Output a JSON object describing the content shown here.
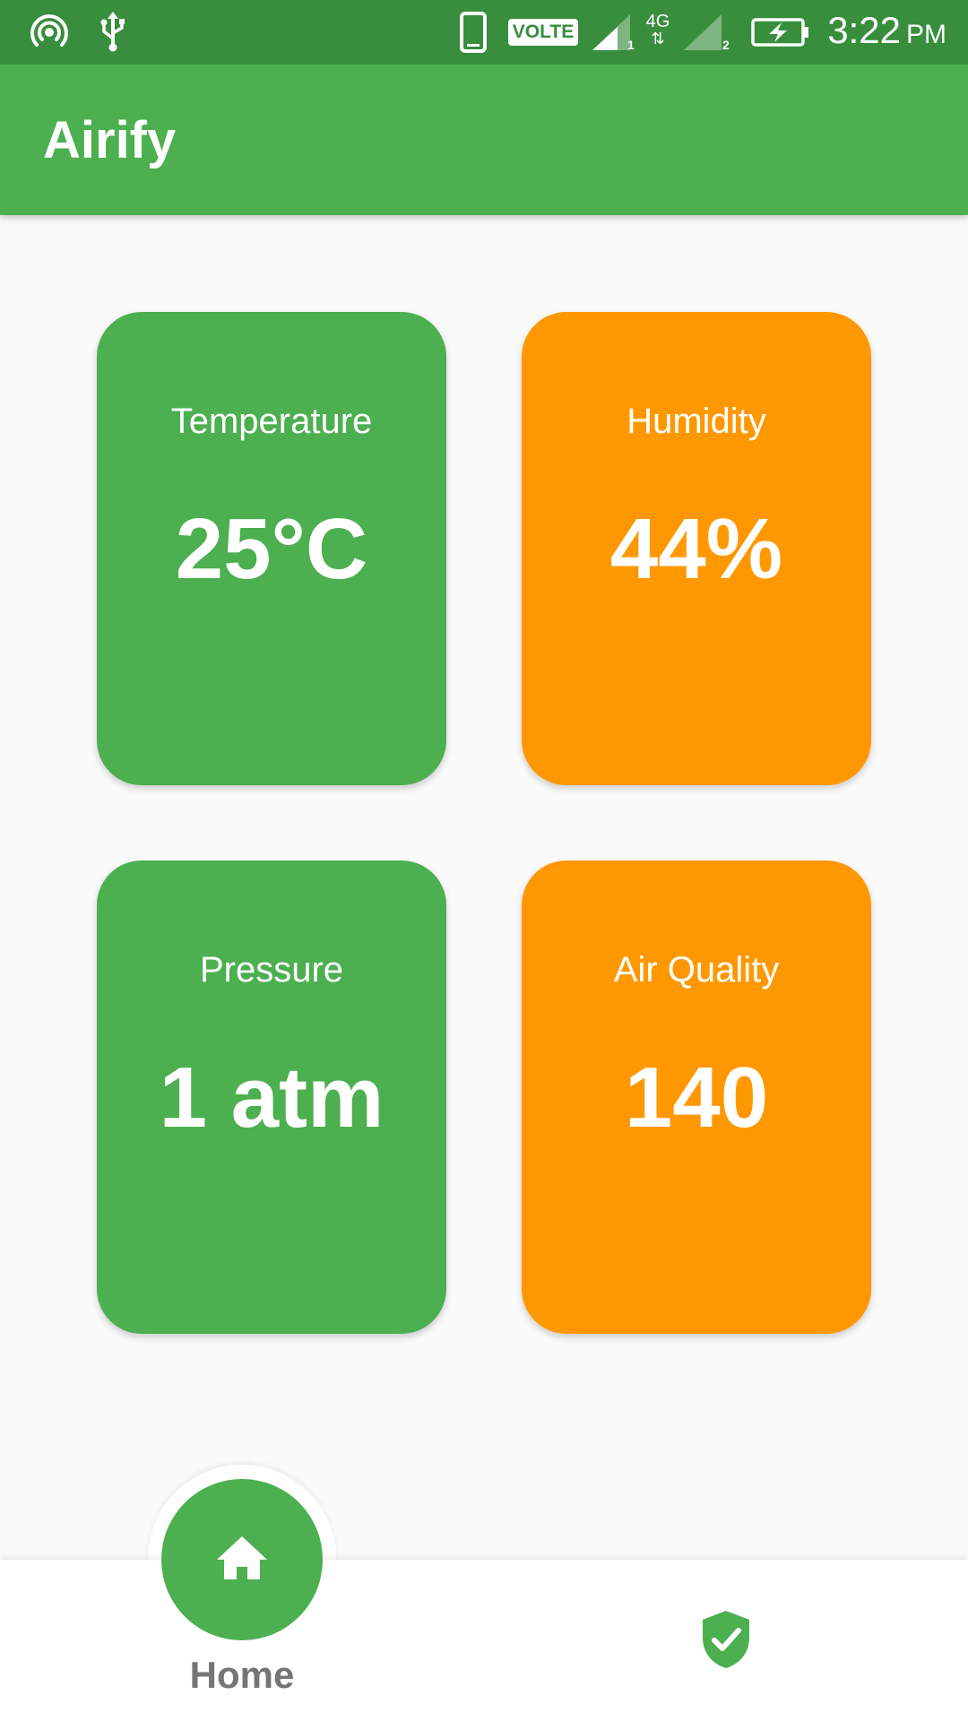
{
  "status_bar": {
    "icons": [
      "hotspot-icon",
      "usb-icon",
      "phone-icon",
      "volte-icon",
      "signal-icon",
      "signal-icon",
      "battery-charging-icon"
    ],
    "volte_label": "VOLTE",
    "network_label": "4G",
    "sim1": "1",
    "sim2": "2",
    "time": "3:22",
    "ampm": "PM"
  },
  "app_bar": {
    "title": "Airify"
  },
  "cards": [
    {
      "label": "Temperature",
      "value": "25°C",
      "color": "#4caf50"
    },
    {
      "label": "Humidity",
      "value": "44%",
      "color": "#ff9800"
    },
    {
      "label": "Pressure",
      "value": "1 atm",
      "color": "#4caf50"
    },
    {
      "label": "Air Quality",
      "value": "140",
      "color": "#ff9800"
    }
  ],
  "bottom_nav": {
    "home_label": "Home",
    "home_icon": "home-icon",
    "second_icon": "shield-check-icon",
    "accent": "#4caf50"
  }
}
